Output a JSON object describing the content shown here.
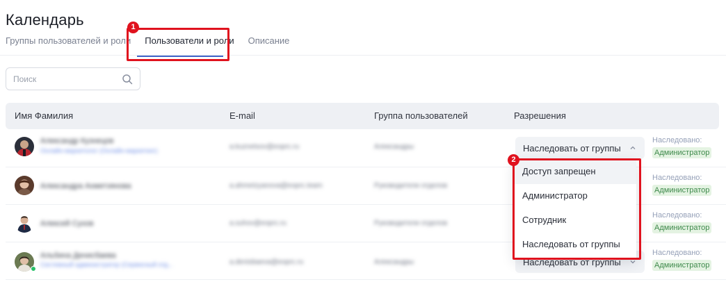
{
  "page": {
    "title": "Календарь"
  },
  "tabs": [
    {
      "label": "Группы пользователей и роли",
      "active": false
    },
    {
      "label": "Пользователи и роли",
      "active": true
    },
    {
      "label": "Описание",
      "active": false
    }
  ],
  "callouts": [
    "1",
    "2"
  ],
  "search": {
    "placeholder": "Поиск"
  },
  "table": {
    "headers": [
      "Имя Фамилия",
      "E-mail",
      "Группа пользователей",
      "Разрешения"
    ],
    "rows": [
      {
        "name": "Александр Кузнецов",
        "subtitle": "Онлайн-маркетолог (Онлайн-маркетинг)",
        "email": "a.kuznetsov@eoprc.ru",
        "group": "Александры",
        "permission": "Наследовать от группы",
        "inherited_label": "Наследовано:",
        "inherited_value": "Администратор",
        "online": false
      },
      {
        "name": "Александра Ахметзянова",
        "subtitle": "",
        "email": "a.ahmetzyanova@eoprc.team",
        "group": "Руководители отделов",
        "permission": "Наследовать от группы",
        "inherited_label": "Наследовано:",
        "inherited_value": "Администратор",
        "online": false
      },
      {
        "name": "Алексей Сухов",
        "subtitle": "",
        "email": "a.suhov@eoprc.ru",
        "group": "Руководители отделов",
        "permission": "Наследовать от группы",
        "inherited_label": "Наследовано:",
        "inherited_value": "Администратор",
        "online": false
      },
      {
        "name": "Альбина Денисбаева",
        "subtitle": "Системный администратор (Сервисный отд...",
        "email": "a.denisbaeva@eoprc.ru",
        "group": "Александры",
        "permission": "Наследовать от группы",
        "inherited_label": "Наследовано:",
        "inherited_value": "Администратор",
        "online": true
      }
    ]
  },
  "dropdown": {
    "options": [
      "Доступ запрещен",
      "Администратор",
      "Сотрудник",
      "Наследовать от группы"
    ],
    "hovered_index": 0
  },
  "colors": {
    "accent": "#3f63c8",
    "callout": "#e0121e",
    "inherited_badge_bg": "#e4f3e2",
    "inherited_badge_text": "#3f8a4c"
  }
}
